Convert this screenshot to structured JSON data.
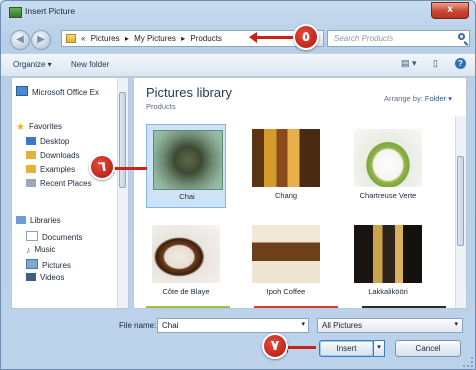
{
  "window": {
    "title": "Insert Picture",
    "close_label": "x"
  },
  "address": {
    "crumbs": [
      "«",
      "Pictures",
      "▸",
      "My Pictures",
      "▸",
      "Products"
    ],
    "search_placeholder": "Search Products"
  },
  "toolbar": {
    "organize": "Organize ▾",
    "new_folder": "New folder"
  },
  "nav": {
    "items": [
      {
        "label": "Microsoft Office Ex"
      },
      {
        "label": "Favorites"
      },
      {
        "label": "Desktop"
      },
      {
        "label": "Downloads"
      },
      {
        "label": "Examples"
      },
      {
        "label": "Recent Places"
      },
      {
        "label": "Libraries"
      },
      {
        "label": "Documents"
      },
      {
        "label": "Music"
      },
      {
        "label": "Pictures"
      },
      {
        "label": "Videos"
      }
    ]
  },
  "library": {
    "title": "Pictures library",
    "subtitle": "Products",
    "arrange_label": "Arrange by:",
    "arrange_value": "Folder ▾"
  },
  "files": [
    {
      "name": "Chai"
    },
    {
      "name": "Chang"
    },
    {
      "name": "Chartreuse Verte"
    },
    {
      "name": "Côte de Blaye"
    },
    {
      "name": "Ipoh Coffee"
    },
    {
      "name": "Lakkalikööri"
    }
  ],
  "footer": {
    "file_name_label": "File name:",
    "file_name_value": "Chai",
    "file_type_value": "All Pictures",
    "insert_label": "Insert",
    "cancel_label": "Cancel"
  },
  "callouts": {
    "c5": "٥",
    "c6": "٦",
    "c7": "٧"
  },
  "colors": {
    "accent": "#c8241a",
    "selection": "#cfe3f8"
  }
}
